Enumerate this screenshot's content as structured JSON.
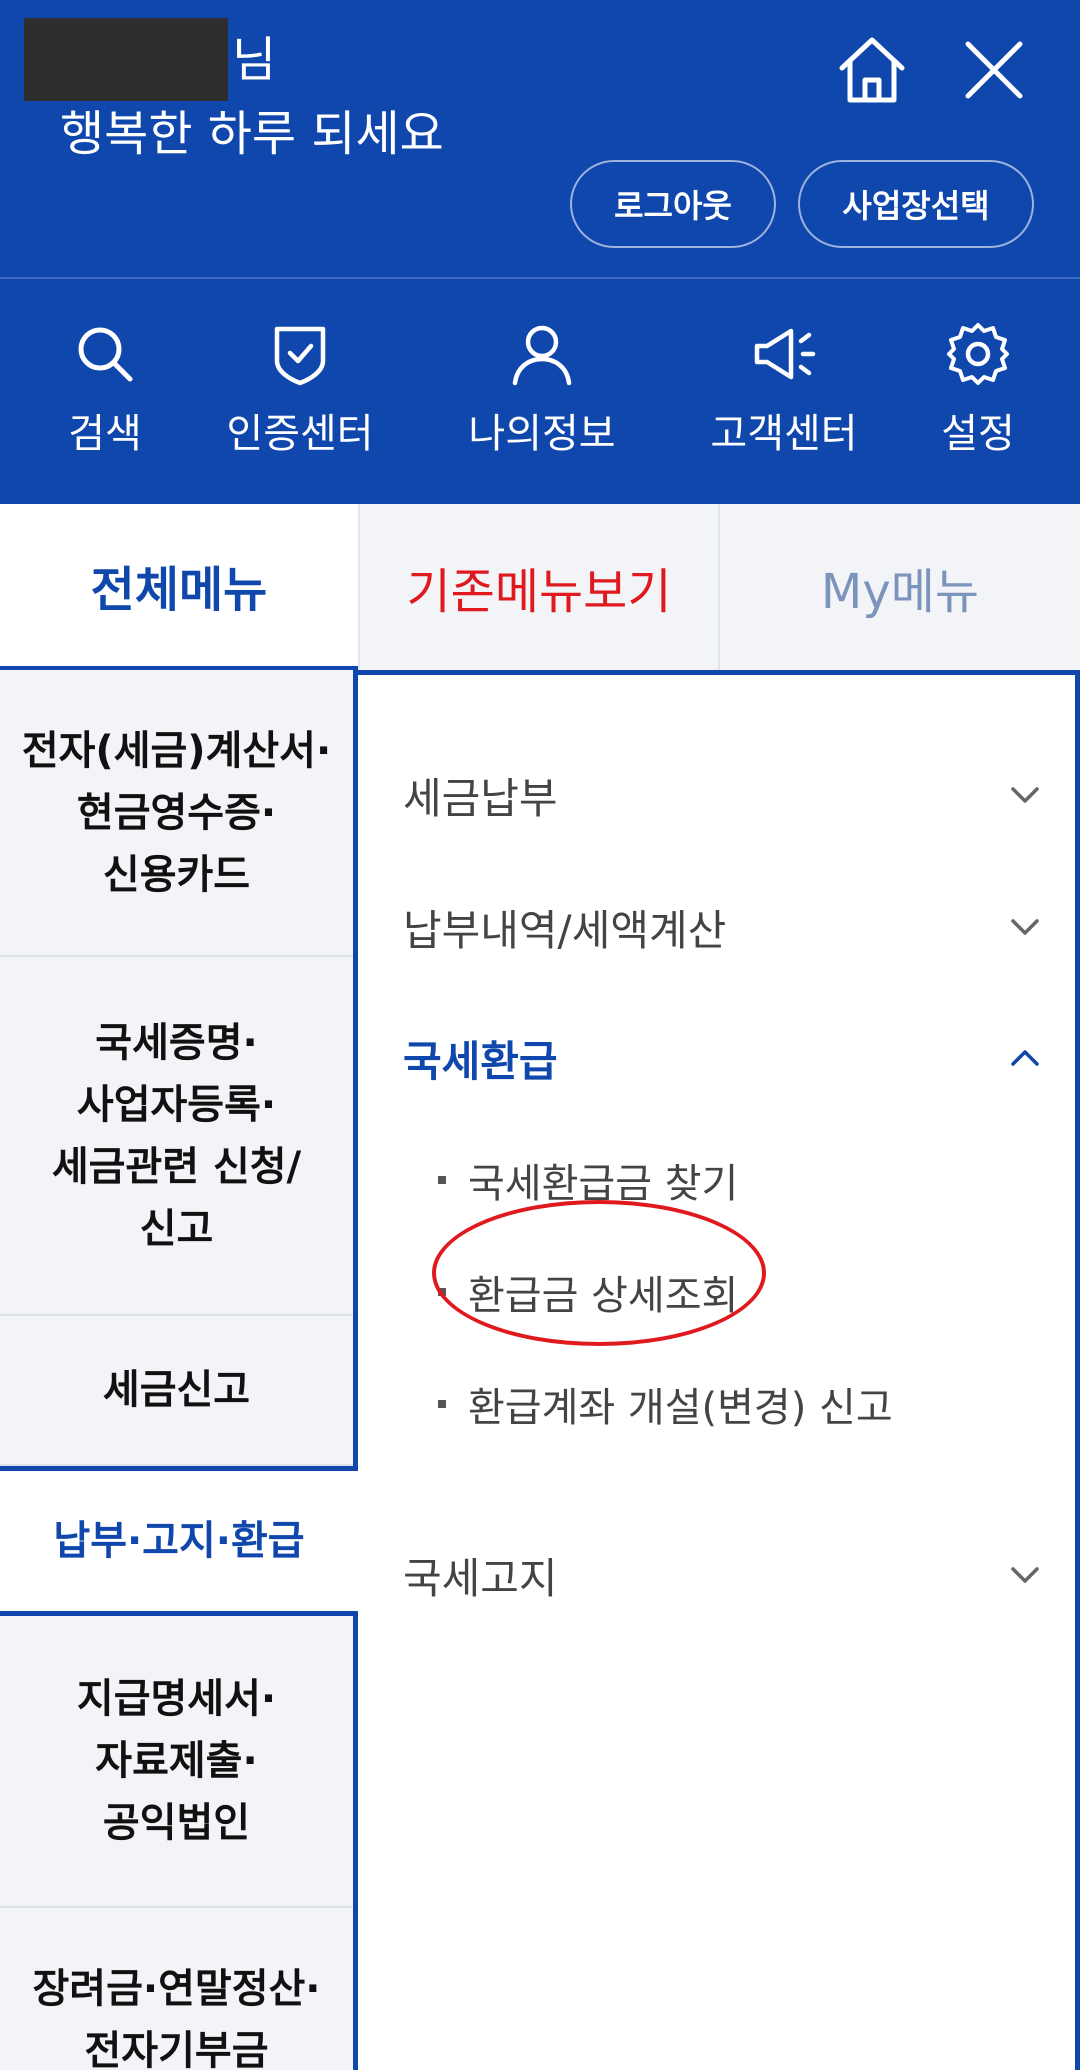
{
  "header": {
    "name_suffix": "님",
    "greeting": "행복한 하루 되세요",
    "logout_label": "로그아웃",
    "business_select_label": "사업장선택",
    "icons": [
      "home-icon",
      "close-icon"
    ]
  },
  "quick_menu": [
    {
      "label": "검색",
      "icon": "search-icon"
    },
    {
      "label": "인증센터",
      "icon": "shield-check-icon"
    },
    {
      "label": "나의정보",
      "icon": "person-icon"
    },
    {
      "label": "고객센터",
      "icon": "megaphone-icon"
    },
    {
      "label": "설정",
      "icon": "gear-icon"
    }
  ],
  "tabs": [
    {
      "label": "전체메뉴",
      "selected": true
    },
    {
      "label": "기존메뉴보기",
      "selected": false
    },
    {
      "label": "My메뉴",
      "selected": false
    }
  ],
  "categories": [
    {
      "label": "전자(세금)계산서·\n현금영수증·\n신용카드"
    },
    {
      "label": "국세증명·\n사업자등록·\n세금관련 신청/\n신고"
    },
    {
      "label": "세금신고"
    },
    {
      "label": "납부·고지·환급",
      "active": true
    },
    {
      "label": "지급명세서·\n자료제출·\n공익법인"
    },
    {
      "label": "장려금·연말정산·\n전자기부금"
    }
  ],
  "menu": {
    "items": [
      {
        "label": "세금납부",
        "expanded": false
      },
      {
        "label": "납부내역/세액계산",
        "expanded": false
      },
      {
        "label": "국세환급",
        "expanded": true,
        "children": [
          "국세환급금 찾기",
          "환급금 상세조회",
          "환급계좌 개설(변경) 신고"
        ]
      },
      {
        "label": "국세고지",
        "expanded": false
      }
    ]
  },
  "colors": {
    "brand_blue": "#0f47ac",
    "accent_red": "#e0191f",
    "muted_blue": "#7c94bb"
  }
}
